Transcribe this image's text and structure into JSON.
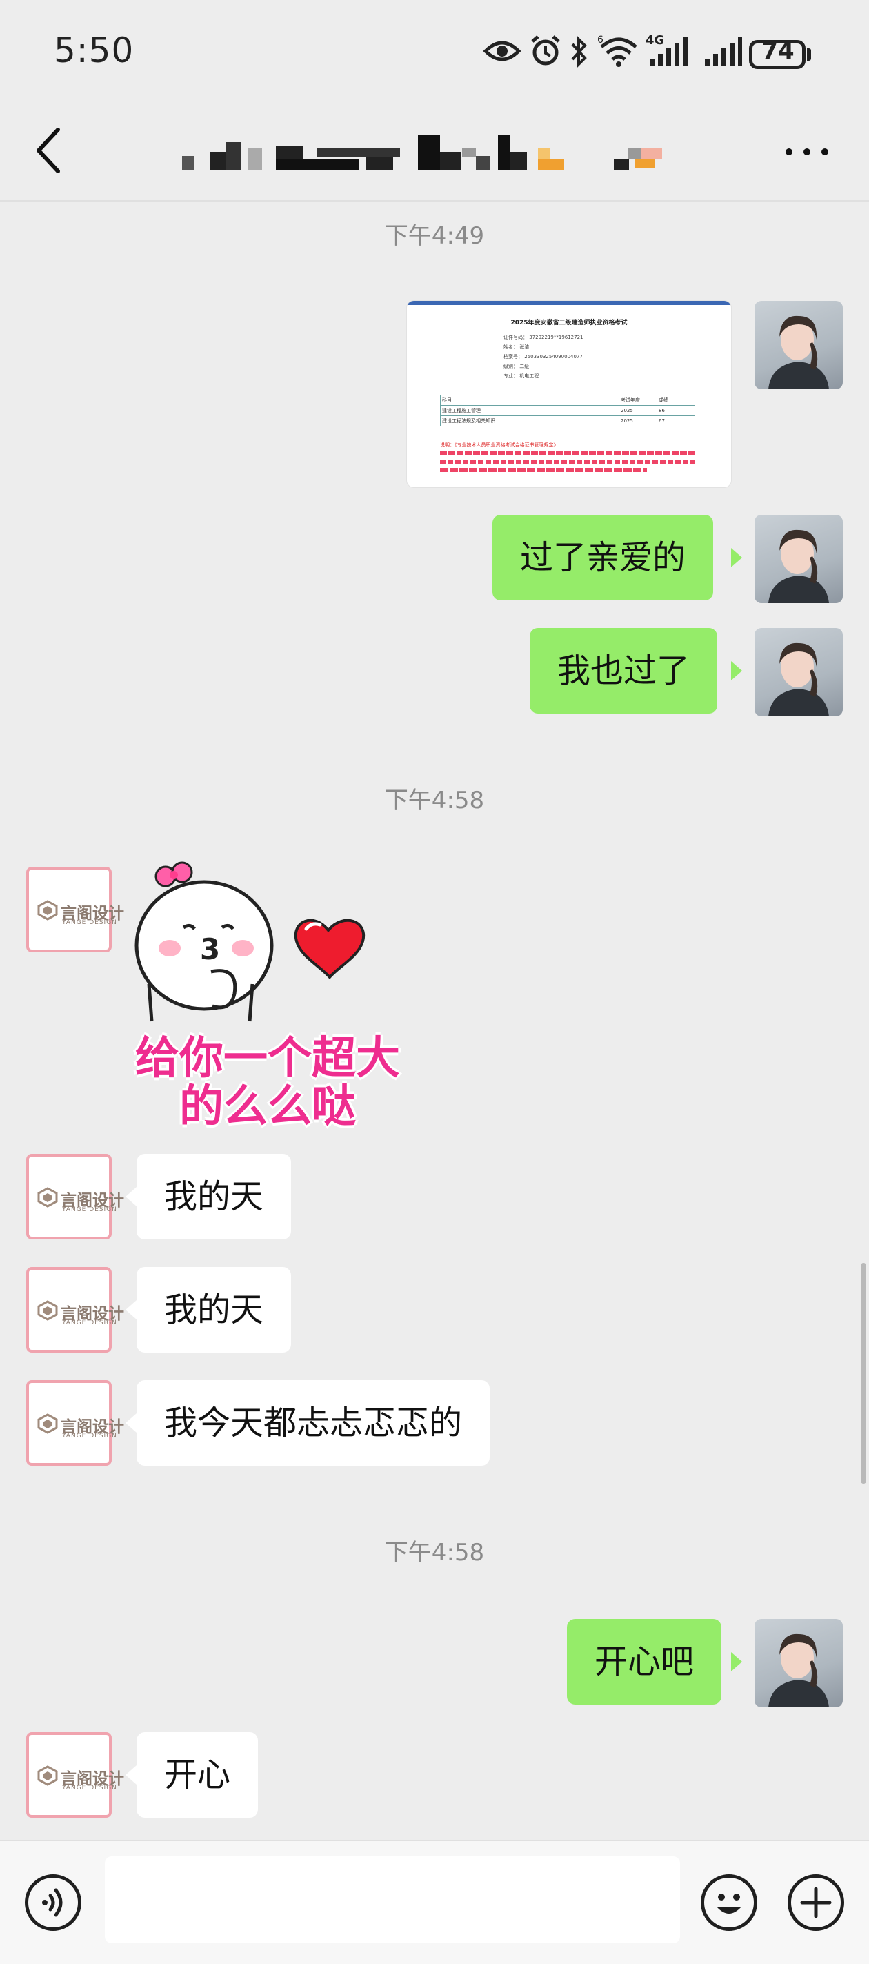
{
  "status_bar": {
    "time": "5:50",
    "battery": "74",
    "network": "4G",
    "wifi_label": "6"
  },
  "nav": {
    "title": "",
    "back_icon": "chevron-left-icon",
    "more_icon": "more-dots-icon"
  },
  "timestamps": [
    "下午4:49",
    "下午4:58",
    "下午4:58"
  ],
  "image_message": {
    "doc_title": "2025年度安徽省二级建造师执业资格考试",
    "doc_fields": [
      {
        "label": "证件号码：",
        "value": "37292219**19612721"
      },
      {
        "label": "姓名：",
        "value": "张洁"
      },
      {
        "label": "档案号：",
        "value": "2503303254090004077"
      },
      {
        "label": "级别：",
        "value": "二级"
      },
      {
        "label": "专业：",
        "value": "机电工程"
      }
    ],
    "doc_table": {
      "headers": [
        "科目",
        "考试年度",
        "成绩"
      ],
      "rows": [
        [
          "建设工程施工管理",
          "2025",
          "86"
        ],
        [
          "建设工程法规及相关知识",
          "2025",
          "67"
        ]
      ]
    },
    "doc_note": "说明：《专业技术人员职业资格考试合格证书管理规定》..."
  },
  "messages": {
    "me_1": "过了亲爱的",
    "me_2": "我也过了",
    "other_1": "我的天",
    "other_2": "我的天",
    "other_3": "我今天都忐忐忑忑的",
    "me_3": "开心吧",
    "other_4": "开心"
  },
  "sticker": {
    "line1": "给你一个超大",
    "line2": "的么么哒"
  },
  "other_avatar": {
    "logo_text": "言阁设计",
    "logo_sub": "YANGE DESIGN"
  },
  "input_bar": {
    "placeholder": "",
    "voice_icon": "voice-icon",
    "emoji_icon": "emoji-icon",
    "add_icon": "plus-icon"
  },
  "colors": {
    "bubble_me": "#95ec69",
    "bubble_other": "#ffffff",
    "background": "#ededed",
    "sticker_pink": "#ee2d8f",
    "avatar_border": "#f0a3ae"
  }
}
